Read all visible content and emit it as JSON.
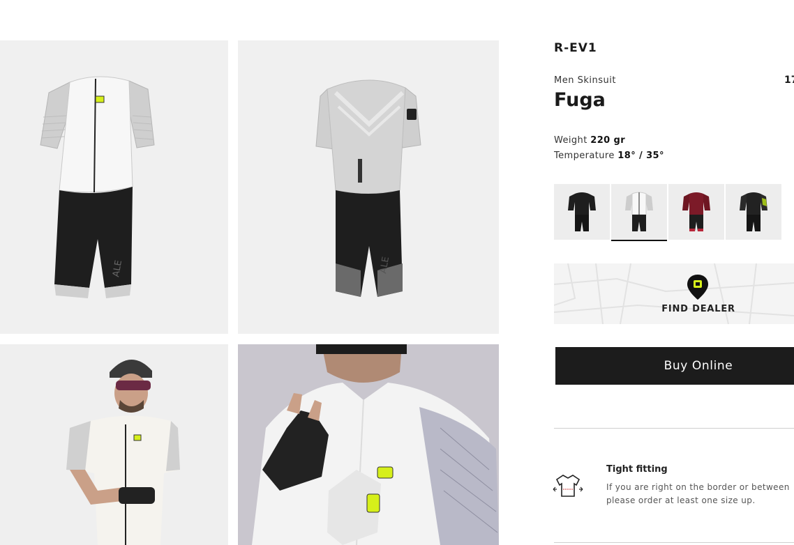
{
  "product": {
    "line": "R-EV1",
    "category": "Men Skinsuit",
    "price": "17",
    "name": "Fuga",
    "weight_label": "Weight",
    "weight_value": "220 gr",
    "temperature_label": "Temperature",
    "temperature_value": "18° / 35°"
  },
  "gallery": [
    {
      "name": "skinsuit-front-view"
    },
    {
      "name": "skinsuit-back-view"
    },
    {
      "name": "model-wearing-skinsuit"
    },
    {
      "name": "model-closeup-gloves"
    }
  ],
  "variants": [
    {
      "color": "black",
      "selected": false
    },
    {
      "color": "white",
      "selected": true
    },
    {
      "color": "bordeaux",
      "selected": false
    },
    {
      "color": "black-lime",
      "selected": false
    }
  ],
  "dealer": {
    "label": "FIND DEALER",
    "icon": "location-pin-icon"
  },
  "buy": {
    "label": "Buy Online"
  },
  "fit": {
    "icon": "jersey-icon",
    "title": "Tight fitting",
    "text": "If you are right on the border or between please order at least one size up."
  },
  "colors": {
    "accent": "#1c1c1c",
    "brand_yellow": "#d6ef1a",
    "background_tile": "#f0f0f0"
  }
}
